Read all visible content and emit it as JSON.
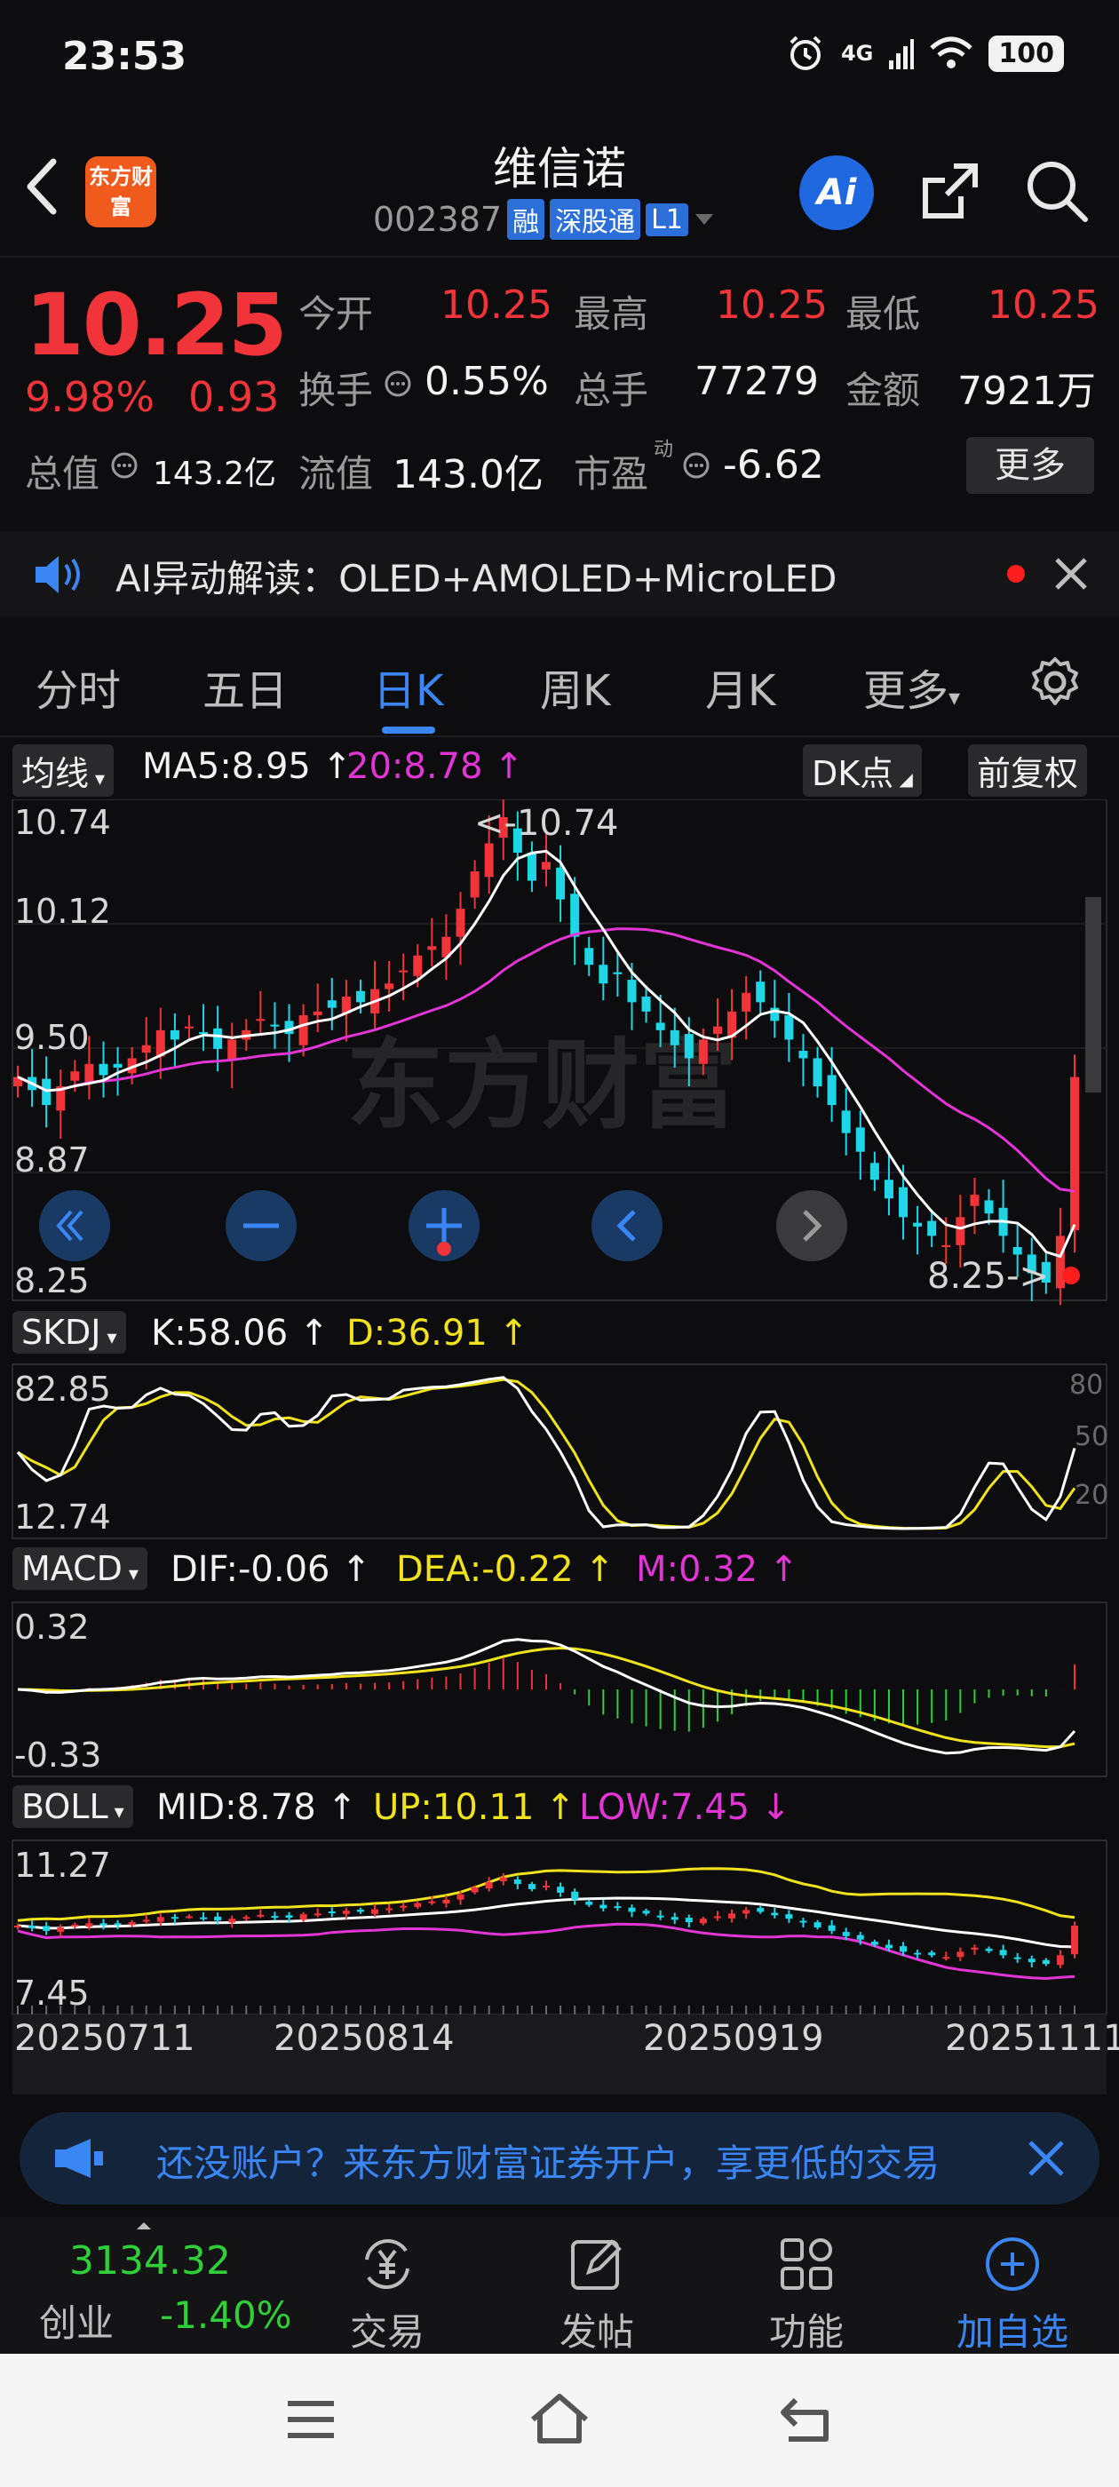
{
  "status_bar": {
    "time": "23:53",
    "network": "4G",
    "battery": "100"
  },
  "header": {
    "logo_text": "东方财富",
    "stock_name": "维信诺",
    "stock_code": "002387",
    "tags": [
      "融",
      "深股通",
      "L1"
    ],
    "ai_label": "Ai"
  },
  "quote": {
    "price": "10.25",
    "change_pct": "9.98%",
    "change": "0.93",
    "fields": [
      {
        "label": "今开",
        "value": "10.25",
        "color": "#f0343a"
      },
      {
        "label": "最高",
        "value": "10.25",
        "color": "#f0343a"
      },
      {
        "label": "最低",
        "value": "10.25",
        "color": "#f0343a"
      },
      {
        "label": "换手",
        "value": "0.55%",
        "color": "#f2f2f2"
      },
      {
        "label": "总手",
        "value": "77279",
        "color": "#f2f2f2"
      },
      {
        "label": "金额",
        "value": "7921万",
        "color": "#f2f2f2"
      },
      {
        "label": "总值",
        "value": "143.2亿",
        "color": "#f2f2f2"
      },
      {
        "label": "流值",
        "value": "143.0亿",
        "color": "#f2f2f2"
      },
      {
        "label": "市盈",
        "value": "-6.62",
        "color": "#f2f2f2"
      }
    ],
    "pe_superscript": "动",
    "more_label": "更多"
  },
  "ai_banner": {
    "text": "AI异动解读：OLED+AMOLED+MicroLED"
  },
  "tabs": [
    "分时",
    "五日",
    "日K",
    "周K",
    "月K",
    "更多"
  ],
  "active_tab": "日K",
  "kline": {
    "ma_chip": "均线",
    "ma5": "MA5:8.95 ↑",
    "ma20": "20:8.78 ↑",
    "dk_chip": "DK点",
    "fq_chip": "前复权",
    "y_labels": [
      "10.74",
      "10.12",
      "9.50",
      "8.87",
      "8.25"
    ],
    "high_note": "<-10.74",
    "low_note": "8.25->",
    "watermark": "东方财富"
  },
  "skdj": {
    "chip": "SKDJ",
    "k": "K:58.06 ↑",
    "d": "D:36.91 ↑",
    "y_top": "82.85",
    "y_bottom": "12.74",
    "right_labels": [
      "80",
      "50",
      "20"
    ]
  },
  "macd": {
    "chip": "MACD",
    "dif": "DIF:-0.06 ↑",
    "dea": "DEA:-0.22 ↑",
    "m": "M:0.32 ↑",
    "y_top": "0.32",
    "y_bottom": "-0.33"
  },
  "boll": {
    "chip": "BOLL",
    "mid": "MID:8.78 ↑",
    "up": "UP:10.11 ↑",
    "low": "LOW:7.45 ↓",
    "y_top": "11.27",
    "y_bottom": "7.45"
  },
  "dates": [
    "20250711",
    "20250814",
    "20250919",
    "20251111"
  ],
  "promo": {
    "text": "还没账户？来东方财富证券开户，享更低的交易"
  },
  "bottom_nav": {
    "index_value": "3134.32",
    "index_name": "创业",
    "index_change": "-1.40%",
    "items": [
      "交易",
      "发帖",
      "功能",
      "加自选"
    ]
  },
  "chart_data": {
    "type": "candlestick",
    "close_approx": [
      9.35,
      9.28,
      9.2,
      9.3,
      9.38,
      9.42,
      9.36,
      9.4,
      9.45,
      9.52,
      9.6,
      9.55,
      9.62,
      9.58,
      9.5,
      9.55,
      9.6,
      9.66,
      9.62,
      9.58,
      9.68,
      9.7,
      9.72,
      9.78,
      9.75,
      9.82,
      9.85,
      9.92,
      10.0,
      10.05,
      10.1,
      10.25,
      10.45,
      10.6,
      10.74,
      10.55,
      10.4,
      10.5,
      10.3,
      10.1,
      9.95,
      9.85,
      9.9,
      9.75,
      9.7,
      9.6,
      9.52,
      9.45,
      9.55,
      9.62,
      9.7,
      9.8,
      9.75,
      9.65,
      9.55,
      9.45,
      9.3,
      9.2,
      9.05,
      8.95,
      8.8,
      8.7,
      8.6,
      8.55,
      8.5,
      8.45,
      8.6,
      8.72,
      8.62,
      8.5,
      8.4,
      8.3,
      8.25,
      8.5,
      9.35
    ],
    "ma5_last": 8.95,
    "ma20_last": 8.78,
    "y_range": [
      8.25,
      10.74
    ]
  }
}
